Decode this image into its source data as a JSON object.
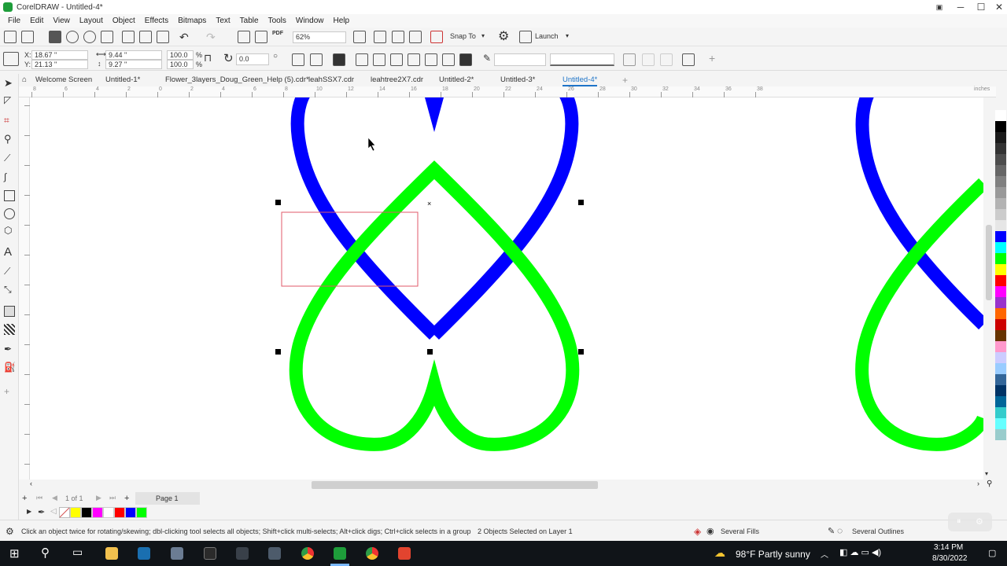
{
  "app": {
    "title": "CorelDRAW - Untitled-4*"
  },
  "window_controls": {
    "minimize": "─",
    "maximize": "☐",
    "close": "✕"
  },
  "menu": [
    "File",
    "Edit",
    "View",
    "Layout",
    "Object",
    "Effects",
    "Bitmaps",
    "Text",
    "Table",
    "Tools",
    "Window",
    "Help"
  ],
  "toolbar": {
    "zoom": "62%",
    "snap_to": "Snap To",
    "launch": "Launch"
  },
  "properties": {
    "x": "18.67 \"",
    "y": "21.13 \"",
    "width": "9.44 \"",
    "height": "9.27 \"",
    "scale_w": "100.0",
    "scale_h": "100.0",
    "pct": "%",
    "rotation": "0.0"
  },
  "tabs": [
    "Welcome Screen",
    "Untitled-1*",
    "Flower_3layers_Doug_Green_Help (5).cdr*",
    "leahSSX7.cdr",
    "leahtree2X7.cdr",
    "Untitled-2*",
    "Untitled-3*",
    "Untitled-4*"
  ],
  "active_tab": "Untitled-4*",
  "ruler": {
    "unit": "inches",
    "ticks": [
      "8",
      "6",
      "4",
      "2",
      "0",
      "2",
      "4",
      "6",
      "8",
      "10",
      "12",
      "14",
      "16",
      "18",
      "20",
      "22",
      "24",
      "26",
      "28",
      "30",
      "32",
      "34",
      "36",
      "38"
    ]
  },
  "pagenav": {
    "counter": "1 of 1",
    "page": "Page 1"
  },
  "palette": [
    "#ffffff",
    "#000000",
    "#1a1a1a",
    "#333333",
    "#4d4d4d",
    "#666666",
    "#808080",
    "#999999",
    "#b3b3b3",
    "#cccccc",
    "#e6e6e6",
    "#0000ff",
    "#00ffff",
    "#00ff00",
    "#ffff00",
    "#ff0000",
    "#ff00ff",
    "#9933cc",
    "#ff6600",
    "#cc0000",
    "#663300",
    "#ff99cc",
    "#ccccff",
    "#99ccff",
    "#336699",
    "#003366",
    "#006699",
    "#33cccc",
    "#66ffff",
    "#99cccc"
  ],
  "doc_palette": [
    "#ffff00",
    "#000000",
    "#ff00ff",
    "#ffffff",
    "#ff0000",
    "#0000ff",
    "#00ff00"
  ],
  "status": {
    "hint": "Click an object twice for rotating/skewing; dbl-clicking tool selects all objects; Shift+click multi-selects; Alt+click digs; Ctrl+click selects in a group",
    "selection": "2 Objects Selected on Layer 1",
    "fills": "Several Fills",
    "outlines": "Several Outlines"
  },
  "taskbar": {
    "weather": "98°F  Partly sunny",
    "time": "3:14 PM",
    "date": "8/30/2022"
  },
  "colors": {
    "blue_shape": "#0000ff",
    "green_shape": "#00ff00",
    "selection_box": "#e05a6a"
  }
}
